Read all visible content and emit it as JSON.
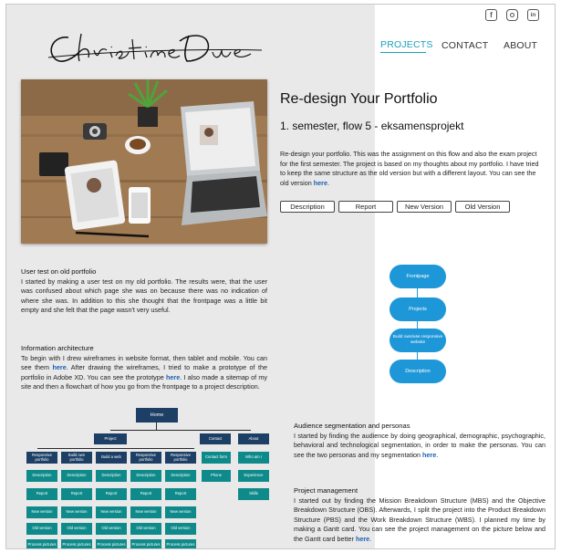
{
  "logo": {
    "text": "Christine Due"
  },
  "social": {
    "items": [
      {
        "name": "facebook-icon",
        "glyph": "f"
      },
      {
        "name": "instagram-icon",
        "glyph": ""
      },
      {
        "name": "linkedin-icon",
        "glyph": "in"
      }
    ]
  },
  "nav": {
    "items": [
      "PROJECTS",
      "CONTACT",
      "ABOUT"
    ],
    "active": "PROJECTS",
    "accent": "#1a9fbf"
  },
  "project": {
    "title": "Re-design Your Portfolio",
    "subtitle": "1. semester, flow 5 - eksamensprojekt",
    "intro": "Re-design your portfolio. This was the assignment on this flow and also the exam project for the first semester. The project is based on my thoughts about my portfolio. I have tried to keep the same structure as the old version but with a different layout. You can see the old version",
    "intro_link": "here",
    "intro_end": "."
  },
  "buttons": [
    "Description",
    "Report",
    "New Version",
    "Old Version"
  ],
  "sections": {
    "user_test": {
      "heading": "User test on old portfolio",
      "text": "I started by making a user test on my old portfolio. The results were, that the user was confused about which page she was on because there was no indication of where she was. In addition to this she thought that the frontpage was a little bit empty and she felt that the page wasn't very useful."
    },
    "info_arch": {
      "heading": "Information architecture",
      "text1": "To begin with I drew wireframes in website format, then tablet and mobile. You can see them",
      "link1": "here",
      "text2": ". After drawing the wireframes, I tried to make a prototype of the portfolio in Adobe XD. You can see the prototype",
      "link2": "here",
      "text3": ". I also made a sitemap of my site and then a flowchart of how you go from the frontpage to a project description."
    },
    "audience": {
      "heading": "Audience segmentation and personas",
      "text": "I started by finding the audience by doing geographical, demographic, psychographic, behavioral and technological segmentation, in order to make the personas. You can see the two personas and my segmentation",
      "link": "here",
      "end": "."
    },
    "pm": {
      "heading": "Project management",
      "text": "I started out by finding the Mission Breakdown Structure (MBS) and the Objective Breakdown Structure (OBS). Afterwards, I split the project into the Product Breakdown Structure (PBS) and the Work Breakdown Structure (WBS). I planned my time by making a Gantt card. You can see the project management on the picture below and the Gantt card better",
      "link": "here",
      "end": "."
    }
  },
  "flowchart": {
    "nodes": [
      "Frontpage",
      "Projects",
      "Build own/use responsive website",
      "Description"
    ]
  },
  "sitemap": {
    "home": "Home",
    "projects": "Project",
    "contact": "Contact",
    "about": "About",
    "columns": [
      [
        "Responsive portfolio",
        "Description",
        "Report",
        "New version",
        "Old version",
        "Process pictures"
      ],
      [
        "Build own portfolio",
        "Description",
        "Report",
        "New version",
        "Old version",
        "Process pictures"
      ],
      [
        "Build a web",
        "Description",
        "Report",
        "New version",
        "Old version",
        "Process pictures"
      ],
      [
        "Responsive portfolio",
        "Description",
        "Report",
        "New version",
        "Old version",
        "Process pictures"
      ],
      [
        "Responsive portfolio",
        "Description",
        "Report",
        "New version",
        "Old version",
        "Process pictures"
      ]
    ],
    "contact_items": [
      "Contact form",
      "Phone"
    ],
    "about_items": [
      "Who am I",
      "Experience",
      "Skills"
    ]
  }
}
